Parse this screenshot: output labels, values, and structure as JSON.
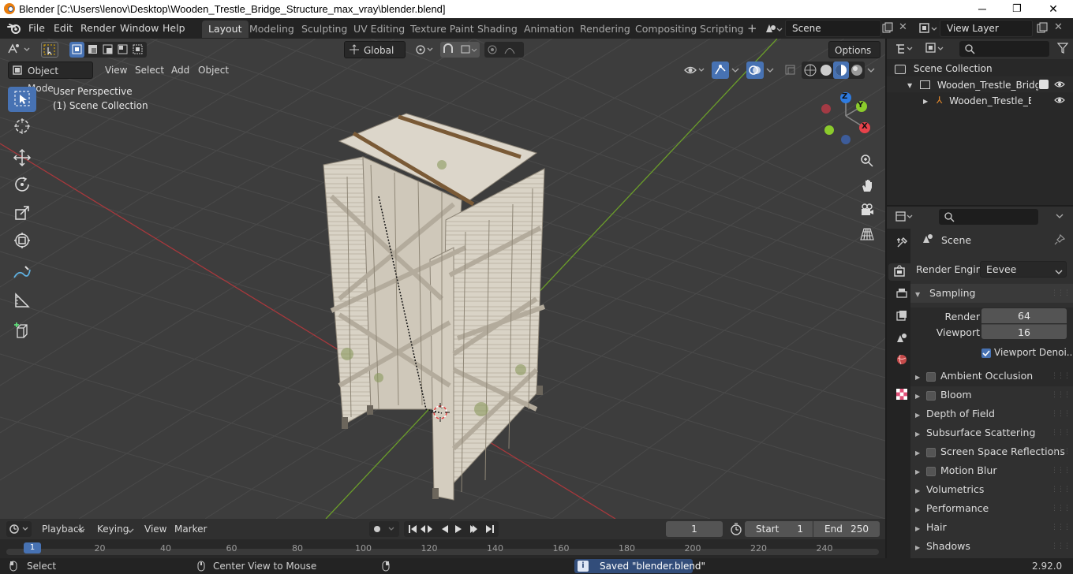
{
  "window": {
    "title": "Blender [C:\\Users\\lenov\\Desktop\\Wooden_Trestle_Bridge_Structure_max_vray\\blender.blend]",
    "minimize": "─",
    "maximize": "❐",
    "close": "✕"
  },
  "menubar": {
    "items": [
      "File",
      "Edit",
      "Render",
      "Window",
      "Help"
    ]
  },
  "workspaces": {
    "tabs": [
      "Layout",
      "Modeling",
      "Sculpting",
      "UV Editing",
      "Texture Paint",
      "Shading",
      "Animation",
      "Rendering",
      "Compositing",
      "Scripting"
    ],
    "active": "Layout"
  },
  "scene": {
    "name": "Scene"
  },
  "view_layer": {
    "name": "View Layer"
  },
  "viewport_header": {
    "mode": "Object Mode",
    "menus": [
      "View",
      "Select",
      "Add",
      "Object"
    ],
    "transform_orientation": "Global",
    "options_label": "Options"
  },
  "viewport_overlay": {
    "perspective": "User Perspective",
    "collection": "(1) Scene Collection"
  },
  "gizmo": {
    "x": "X",
    "y": "Y",
    "z": "Z"
  },
  "outliner": {
    "root": "Scene Collection",
    "collection": "Wooden_Trestle_Bridge_S",
    "object": "Wooden_Trestle_Bric"
  },
  "properties": {
    "context": "Scene",
    "render_engine_label": "Render Engine",
    "render_engine": "Eevee",
    "sampling": {
      "label": "Sampling",
      "render_label": "Render",
      "render_value": "64",
      "viewport_label": "Viewport",
      "viewport_value": "16",
      "denoise_label": "Viewport Denoi..."
    },
    "panels": [
      {
        "label": "Ambient Occlusion",
        "checkbox": true
      },
      {
        "label": "Bloom",
        "checkbox": true
      },
      {
        "label": "Depth of Field",
        "checkbox": false
      },
      {
        "label": "Subsurface Scattering",
        "checkbox": false
      },
      {
        "label": "Screen Space Reflections",
        "checkbox": true
      },
      {
        "label": "Motion Blur",
        "checkbox": true
      },
      {
        "label": "Volumetrics",
        "checkbox": false
      },
      {
        "label": "Performance",
        "checkbox": false
      },
      {
        "label": "Hair",
        "checkbox": false
      },
      {
        "label": "Shadows",
        "checkbox": false
      }
    ]
  },
  "timeline": {
    "menus": [
      "Playback",
      "Keying",
      "View",
      "Marker"
    ],
    "current_frame": "1",
    "start_label": "Start",
    "start": "1",
    "end_label": "End",
    "end": "250",
    "ruler": [
      "1",
      "20",
      "40",
      "60",
      "80",
      "100",
      "120",
      "140",
      "160",
      "180",
      "200",
      "220",
      "240"
    ]
  },
  "statusbar": {
    "select": "Select",
    "center_view": "Center View to Mouse",
    "message": "Saved \"blender.blend\"",
    "version": "2.92.0"
  }
}
